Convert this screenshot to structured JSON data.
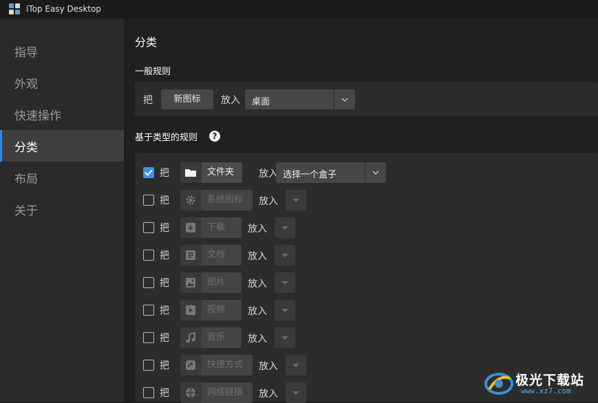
{
  "app": {
    "title": "iTop Easy Desktop"
  },
  "sidebar": {
    "items": [
      {
        "label": "指导",
        "active": false
      },
      {
        "label": "外观",
        "active": false
      },
      {
        "label": "快速操作",
        "active": false
      },
      {
        "label": "分类",
        "active": true
      },
      {
        "label": "布局",
        "active": false
      },
      {
        "label": "关于",
        "active": false
      }
    ]
  },
  "main": {
    "title": "分类",
    "general": {
      "heading": "一般规则",
      "put_label": "把",
      "item_button": "新图标",
      "into_label": "放入",
      "target_value": "桌面"
    },
    "type_rules": {
      "heading": "基于类型的规则",
      "help": "?",
      "rows": [
        {
          "checked": true,
          "put": "把",
          "icon": "folder-icon",
          "name": "文件夹",
          "into": "放入",
          "target": "选择一个盒子"
        },
        {
          "checked": false,
          "put": "把",
          "icon": "gear-icon",
          "name": "系统图标",
          "into": "放入",
          "target": ""
        },
        {
          "checked": false,
          "put": "把",
          "icon": "download-icon",
          "name": "下载",
          "into": "放入",
          "target": ""
        },
        {
          "checked": false,
          "put": "把",
          "icon": "document-icon",
          "name": "文档",
          "into": "放入",
          "target": ""
        },
        {
          "checked": false,
          "put": "把",
          "icon": "image-icon",
          "name": "图片",
          "into": "放入",
          "target": ""
        },
        {
          "checked": false,
          "put": "把",
          "icon": "video-icon",
          "name": "视频",
          "into": "放入",
          "target": ""
        },
        {
          "checked": false,
          "put": "把",
          "icon": "music-icon",
          "name": "音乐",
          "into": "放入",
          "target": ""
        },
        {
          "checked": false,
          "put": "把",
          "icon": "shortcut-icon",
          "name": "快捷方式",
          "into": "放入",
          "target": ""
        },
        {
          "checked": false,
          "put": "把",
          "icon": "globe-icon",
          "name": "网络链接",
          "into": "放入",
          "target": ""
        }
      ]
    }
  },
  "watermark": {
    "title": "极光下载站",
    "url": "www.xz7.com"
  },
  "colors": {
    "accent": "#2e8ae6",
    "checkbox": "#3c8fe8",
    "sidebar_bg": "#2a2a2a",
    "panel_bg": "#2c2c2c"
  }
}
